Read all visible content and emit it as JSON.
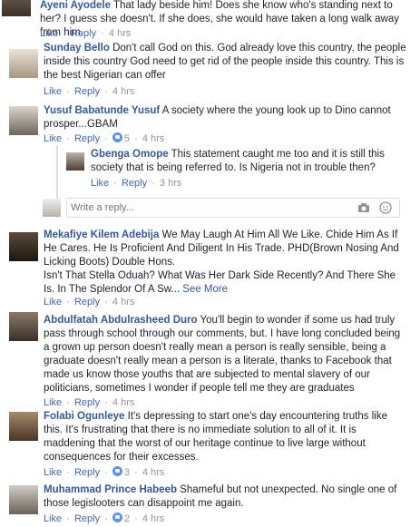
{
  "actions": {
    "like": "Like",
    "reply": "Reply",
    "dot": "·"
  },
  "comments": [
    {
      "author": "Ayeni Ayodele",
      "text": "That lady beside him! Does she know who's standing next to her? I guess she doesn't. If she does, she would have taken a long walk away from him.",
      "time": "4 hrs"
    },
    {
      "author": "Sunday Bello",
      "text": "Don't call God on this. God already love this country, the people inside this country God need to get rid of the people inside this country. This is the best Nigerian can offer",
      "time": "4 hrs"
    },
    {
      "author": "Yusuf Babatunde Yusuf",
      "text": "A society where the young look up to Dino cannot prosper...GBAM",
      "reactions": "5",
      "time": "4 hrs"
    },
    {
      "author": "Gbenga Omope",
      "text": "This statement caught me too and it is still this society that is being referred to. Is Nigeria not in trouble then?",
      "time": "3 hrs"
    },
    {
      "author": "Mekafiye Kilem Adebija",
      "text": "We May Laugh At Him All We Like. Chide Him As If He Cares. He Is Proficient And Diligent In His Trade. PHD(Brown Nosing And Licking Boots) Double Hons.",
      "text2": "Isn't That Stella Oduah? What Was Her Dark Side Recently? And There She Is. In The Splendor Of A Sw...",
      "see_more": "See More",
      "time": "4 hrs"
    },
    {
      "author": "Abdulfatah Abdulrasheed Duro",
      "text": "You'll begin to wonder if some us had truly pass through school through our comments, but. I have long concluded being a grown up person doesn't really mean a person is really sensible, being a graduate doesn't really mean a person is a literate, thanks to Facebook that made us know those youths that are subjected to mental slavery of our politicians, sometimes I wonder if people tell me they are graduates",
      "time": "4 hrs"
    },
    {
      "author": "Folabi Ogunleye",
      "text": "It's depressing to start one's day encountering truths like this. It's frustrating that there is no immediate solution to all of it. It is maddening that the worst of our heritage continue to live large without consequences for their excesses.",
      "reactions": "3",
      "time": "4 hrs"
    },
    {
      "author": "Muhammad Prince Habeeb",
      "text": "Shameful but not unexpected. No single one of those legislooters can disappoint me again.",
      "reactions": "2",
      "time": "4 hrs"
    }
  ],
  "reply_input": {
    "placeholder": "Write a reply..."
  },
  "colors": {
    "author": "#365899",
    "link": "#4267b2",
    "meta": "#90949c",
    "text": "#1d2129"
  }
}
